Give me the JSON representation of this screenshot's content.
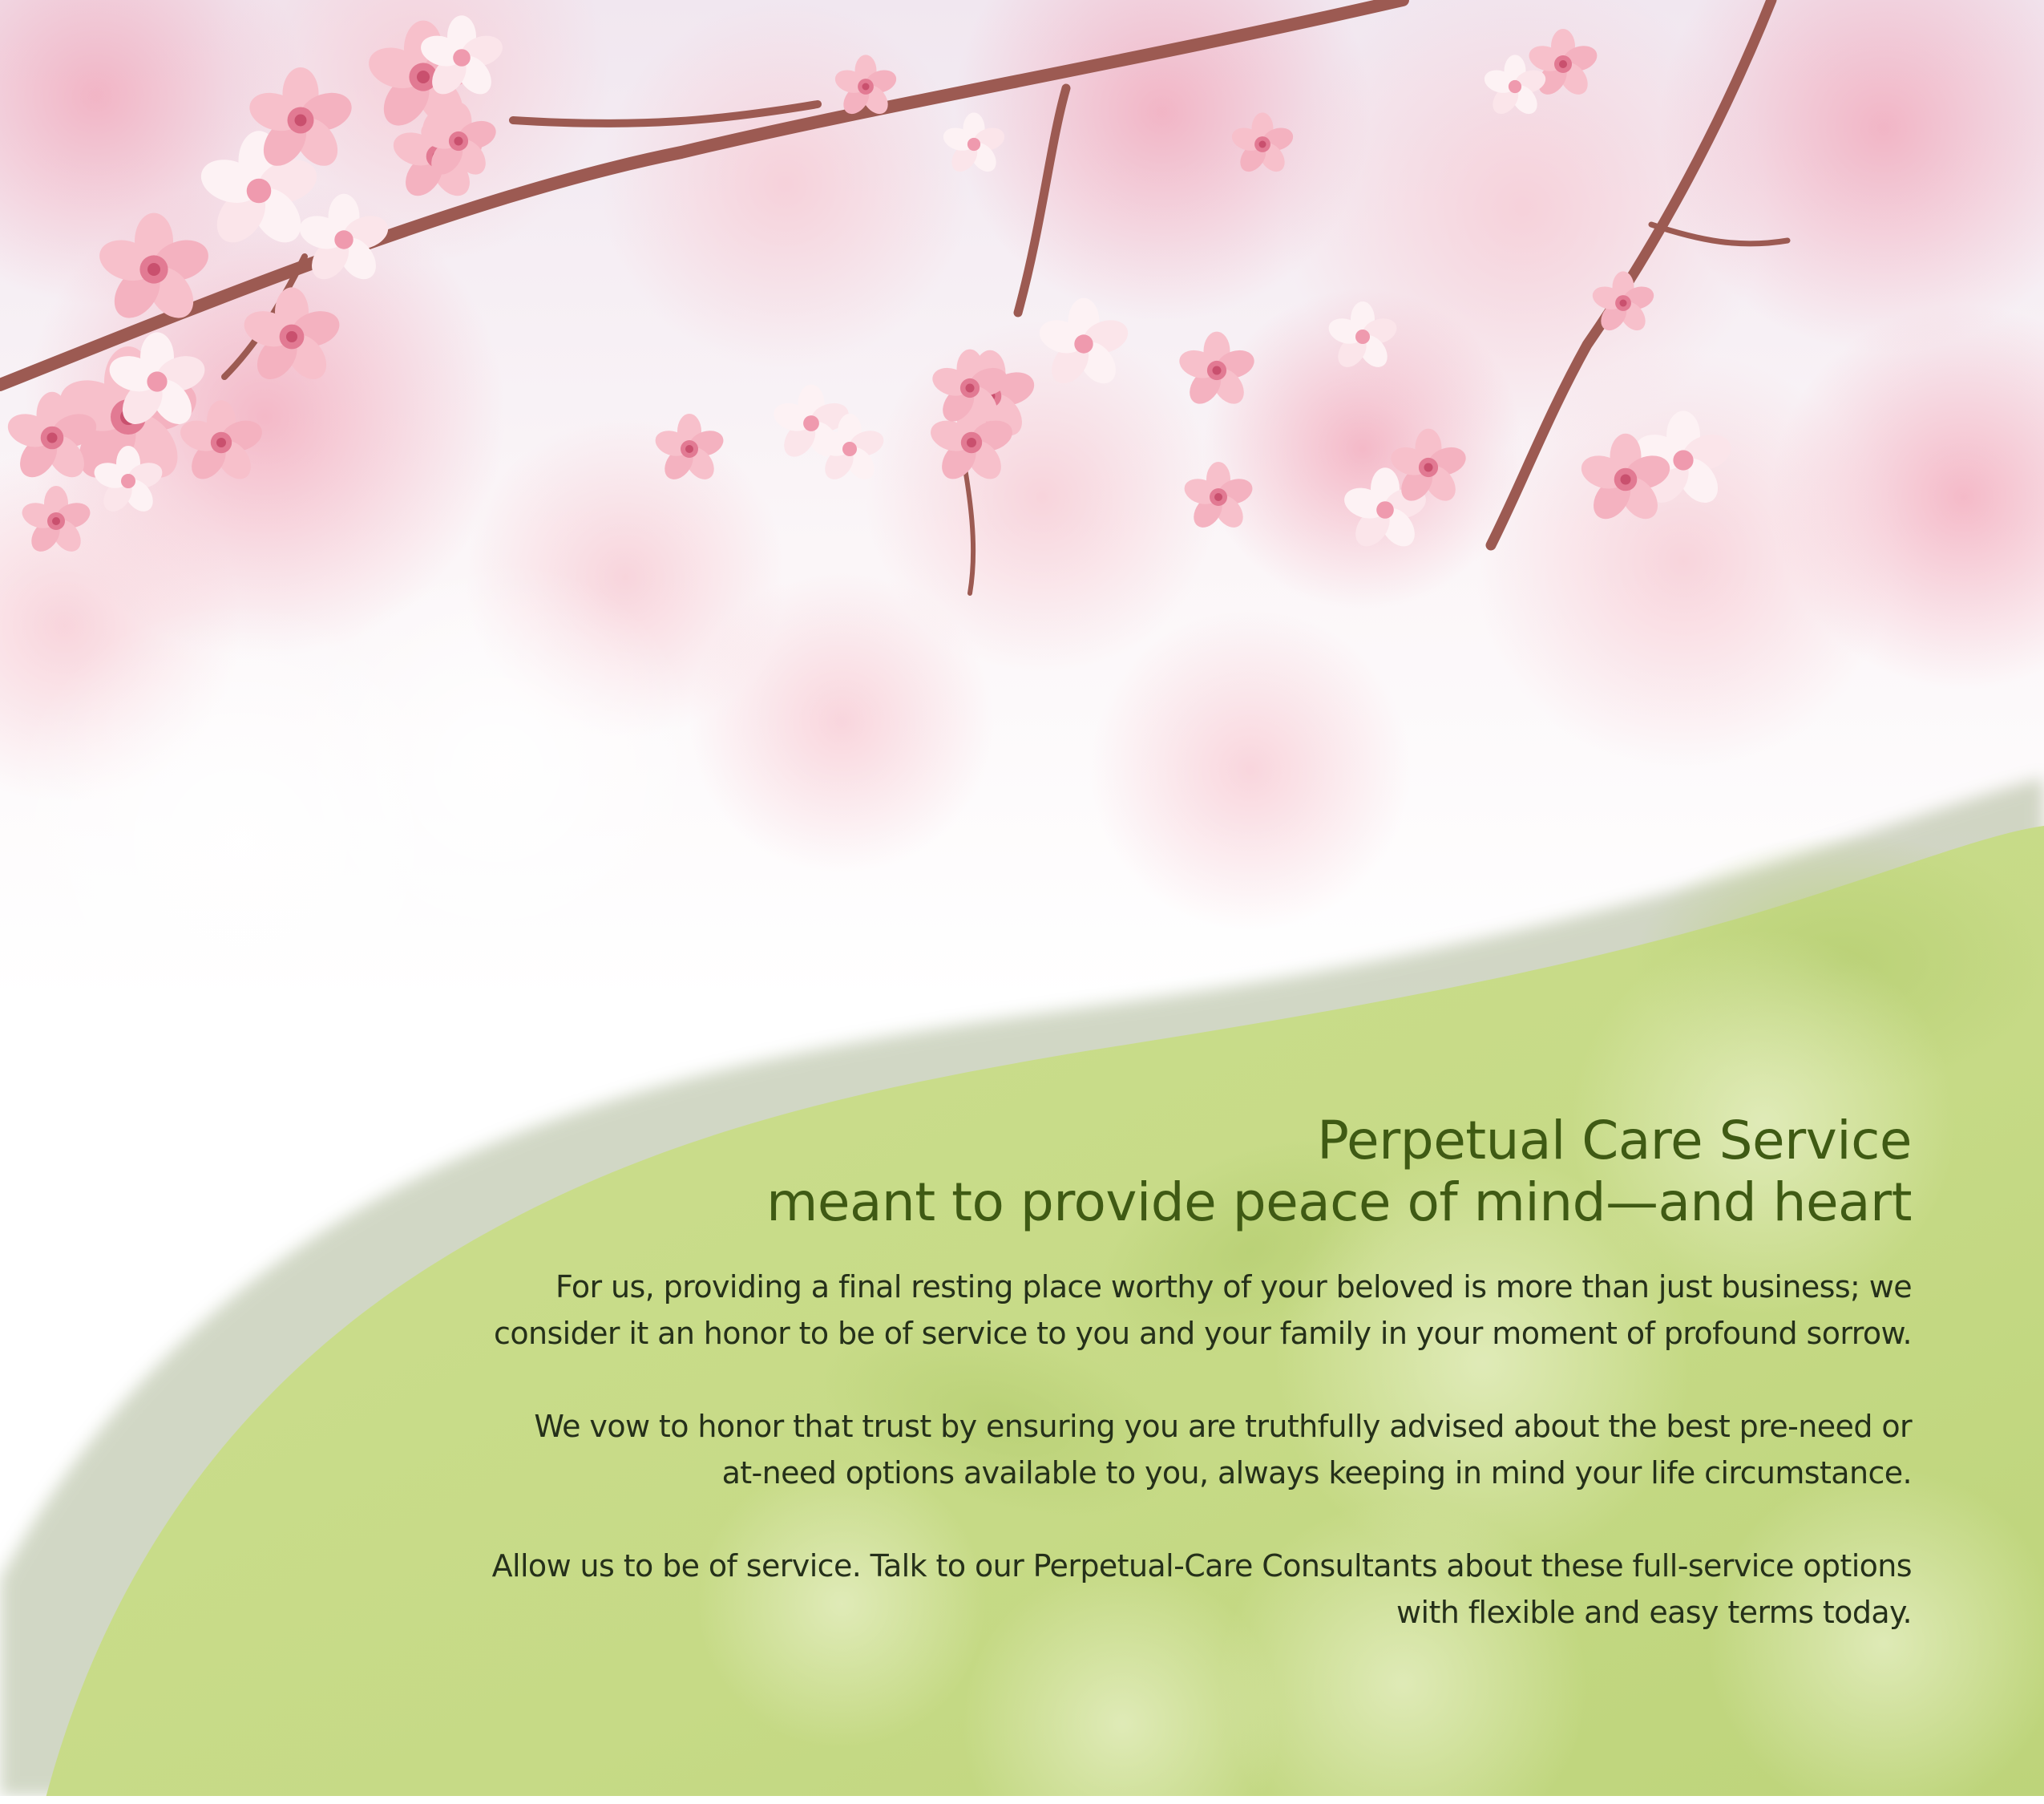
{
  "colors": {
    "green_panel": "#c6da86",
    "green_panel_light": "#d5e4a1",
    "heading": "#3f5a14",
    "body_text": "#25301a",
    "blossom": "#f2a6b4",
    "blossom_dark": "#e27a93",
    "branch": "#9c5a52"
  },
  "heading": {
    "line1": "Perpetual Care Service",
    "line2": "meant to provide peace of mind—and heart"
  },
  "paragraphs": [
    {
      "lines": [
        "For us, providing a final resting place worthy of your beloved is more than just business; we",
        "consider it an honor to be of service to you and your family in your moment of profound sorrow."
      ]
    },
    {
      "lines": [
        "We vow to honor that trust by ensuring you are truthfully advised about the best pre-need or",
        "at-need options available to you, always keeping in mind your life circumstance."
      ]
    },
    {
      "lines": [
        "Allow us to be of service. Talk to our Perpetual-Care Consultants about these full-service options",
        "with flexible and easy terms today."
      ]
    }
  ]
}
